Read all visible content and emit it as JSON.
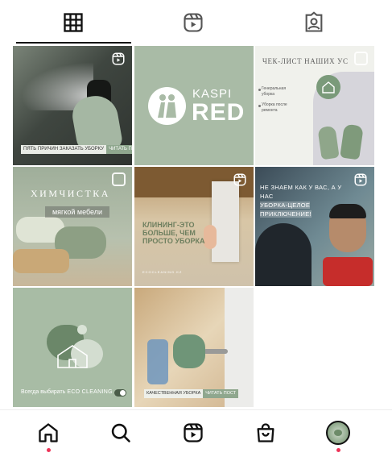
{
  "profile_tabs": [
    {
      "id": "grid",
      "icon": "grid-icon",
      "active": true
    },
    {
      "id": "reels",
      "icon": "reels-icon",
      "active": false
    },
    {
      "id": "tagged",
      "icon": "tagged-person-icon",
      "active": false
    }
  ],
  "posts": [
    {
      "type": "reel",
      "caption_left": "ПЯТЬ ПРИЧИН ЗАКАЗАТЬ УБОРКУ",
      "caption_right": "ЧИТАТЬ ПОСТ"
    },
    {
      "type": "image",
      "logo_top": "KASPI",
      "logo_bottom": "RED"
    },
    {
      "type": "carousel",
      "title": "ЧЕК-ЛИСТ НАШИХ УС",
      "items": [
        "Генеральная уборка",
        "Уборка после ремонта"
      ]
    },
    {
      "type": "carousel",
      "title": "ХИМЧИСТКА",
      "subtitle": "мягкой мебели"
    },
    {
      "type": "reel",
      "headline": "КЛИНИНГ-ЭТО БОЛЬШЕ, ЧЕМ ПРОСТО УБОРКА",
      "footer": "ECOCLEANING.KZ"
    },
    {
      "type": "reel",
      "line1": "НЕ ЗНАЕМ КАК У ВАС, А У НАС",
      "line2": "УБОРКА-ЦЕЛОЕ",
      "line3": "ПРИКЛЮЧЕНИЕ!"
    },
    {
      "type": "image",
      "tagline_prefix": "Всегда выбирать",
      "tagline_brand": "ECO CLEANING"
    },
    {
      "type": "image",
      "caption_left": "КАЧЕСТВЕННАЯ УБОРКА",
      "caption_right": "ЧИТАТЬ ПОСТ"
    }
  ],
  "bottom_nav": [
    {
      "id": "home",
      "icon": "home-icon",
      "has_dot": true
    },
    {
      "id": "search",
      "icon": "search-icon",
      "has_dot": false
    },
    {
      "id": "reels",
      "icon": "reels-icon",
      "has_dot": false
    },
    {
      "id": "shop",
      "icon": "shopping-bag-icon",
      "has_dot": false
    },
    {
      "id": "profile",
      "icon": "profile-avatar",
      "has_dot": true
    }
  ],
  "colors": {
    "brand_green": "#a9bba6",
    "notification_dot": "#ed3458",
    "active_indicator": "#111111"
  }
}
